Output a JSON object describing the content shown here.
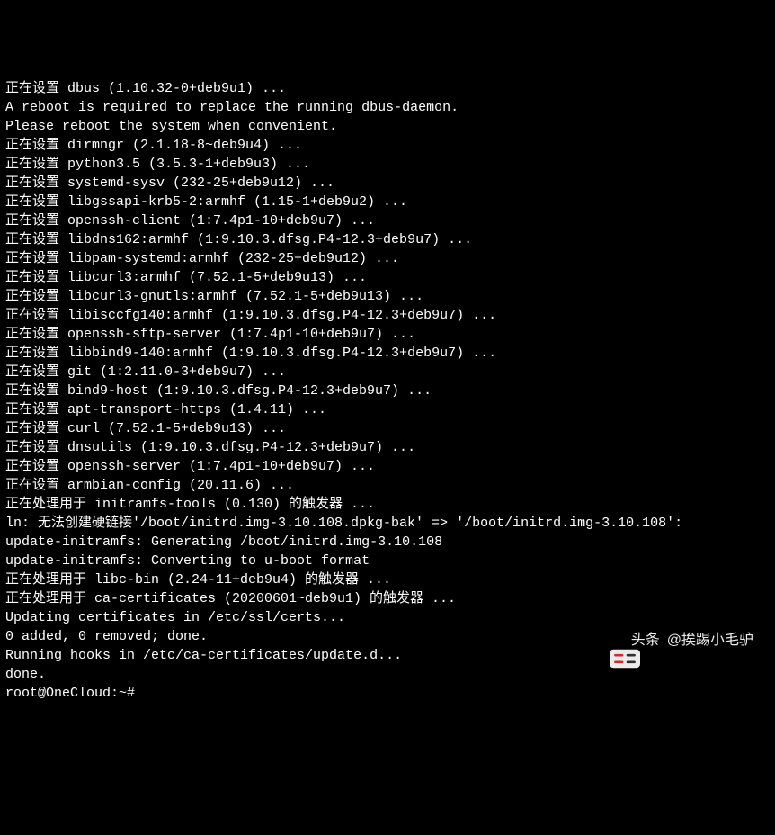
{
  "lines": [
    "正在设置 dbus (1.10.32-0+deb9u1) ...",
    "A reboot is required to replace the running dbus-daemon.",
    "Please reboot the system when convenient.",
    "正在设置 dirmngr (2.1.18-8~deb9u4) ...",
    "正在设置 python3.5 (3.5.3-1+deb9u3) ...",
    "正在设置 systemd-sysv (232-25+deb9u12) ...",
    "正在设置 libgssapi-krb5-2:armhf (1.15-1+deb9u2) ...",
    "正在设置 openssh-client (1:7.4p1-10+deb9u7) ...",
    "正在设置 libdns162:armhf (1:9.10.3.dfsg.P4-12.3+deb9u7) ...",
    "正在设置 libpam-systemd:armhf (232-25+deb9u12) ...",
    "正在设置 libcurl3:armhf (7.52.1-5+deb9u13) ...",
    "正在设置 libcurl3-gnutls:armhf (7.52.1-5+deb9u13) ...",
    "正在设置 libisccfg140:armhf (1:9.10.3.dfsg.P4-12.3+deb9u7) ...",
    "正在设置 openssh-sftp-server (1:7.4p1-10+deb9u7) ...",
    "正在设置 libbind9-140:armhf (1:9.10.3.dfsg.P4-12.3+deb9u7) ...",
    "正在设置 git (1:2.11.0-3+deb9u7) ...",
    "正在设置 bind9-host (1:9.10.3.dfsg.P4-12.3+deb9u7) ...",
    "正在设置 apt-transport-https (1.4.11) ...",
    "正在设置 curl (7.52.1-5+deb9u13) ...",
    "正在设置 dnsutils (1:9.10.3.dfsg.P4-12.3+deb9u7) ...",
    "正在设置 openssh-server (1:7.4p1-10+deb9u7) ...",
    "正在设置 armbian-config (20.11.6) ...",
    "正在处理用于 initramfs-tools (0.130) 的触发器 ...",
    "ln: 无法创建硬链接'/boot/initrd.img-3.10.108.dpkg-bak' => '/boot/initrd.img-3.10.108':",
    "update-initramfs: Generating /boot/initrd.img-3.10.108",
    "update-initramfs: Converting to u-boot format",
    "正在处理用于 libc-bin (2.24-11+deb9u4) 的触发器 ...",
    "正在处理用于 ca-certificates (20200601~deb9u1) 的触发器 ...",
    "Updating certificates in /etc/ssl/certs...",
    "0 added, 0 removed; done.",
    "Running hooks in /etc/ca-certificates/update.d...",
    "done.",
    "root@OneCloud:~#"
  ],
  "watermark": {
    "prefix": "头条",
    "handle": "@挨踢小毛驴"
  }
}
